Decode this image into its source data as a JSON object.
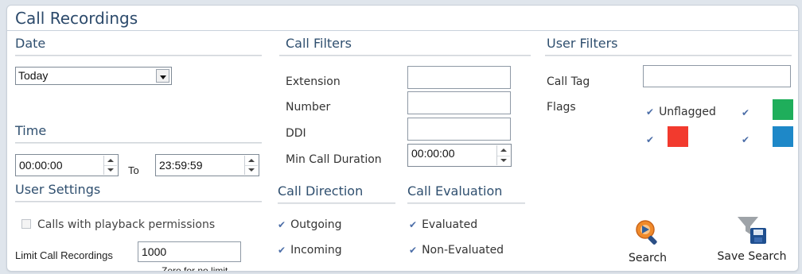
{
  "title": "Call Recordings",
  "date": {
    "heading": "Date",
    "selected": "Today"
  },
  "time": {
    "heading": "Time",
    "from": "00:00:00",
    "to_label": "To",
    "to": "23:59:59"
  },
  "user_settings": {
    "heading": "User Settings",
    "playback_label": "Calls with playback permissions",
    "limit_label": "Limit Call Recordings",
    "limit_value": "1000",
    "limit_hint": "Zero for no limit"
  },
  "call_filters": {
    "heading": "Call Filters",
    "extension_label": "Extension",
    "extension_value": "",
    "number_label": "Number",
    "number_value": "",
    "ddi_label": "DDI",
    "ddi_value": "",
    "min_duration_label": "Min Call Duration",
    "min_duration_value": "00:00:00"
  },
  "call_direction": {
    "heading": "Call Direction",
    "outgoing_label": "Outgoing",
    "incoming_label": "Incoming"
  },
  "call_evaluation": {
    "heading": "Call Evaluation",
    "evaluated_label": "Evaluated",
    "non_evaluated_label": "Non-Evaluated"
  },
  "user_filters": {
    "heading": "User Filters",
    "call_tag_label": "Call Tag",
    "call_tag_value": "",
    "flags_label": "Flags",
    "unflagged_label": "Unflagged",
    "flag_colors": {
      "green": "#1fae5b",
      "red": "#f23a2e",
      "blue": "#1e88c8"
    }
  },
  "actions": {
    "search_label": "Search",
    "save_search_label": "Save Search"
  },
  "icons": {
    "search": "magnifier-icon",
    "save_search": "filter-save-icon"
  }
}
